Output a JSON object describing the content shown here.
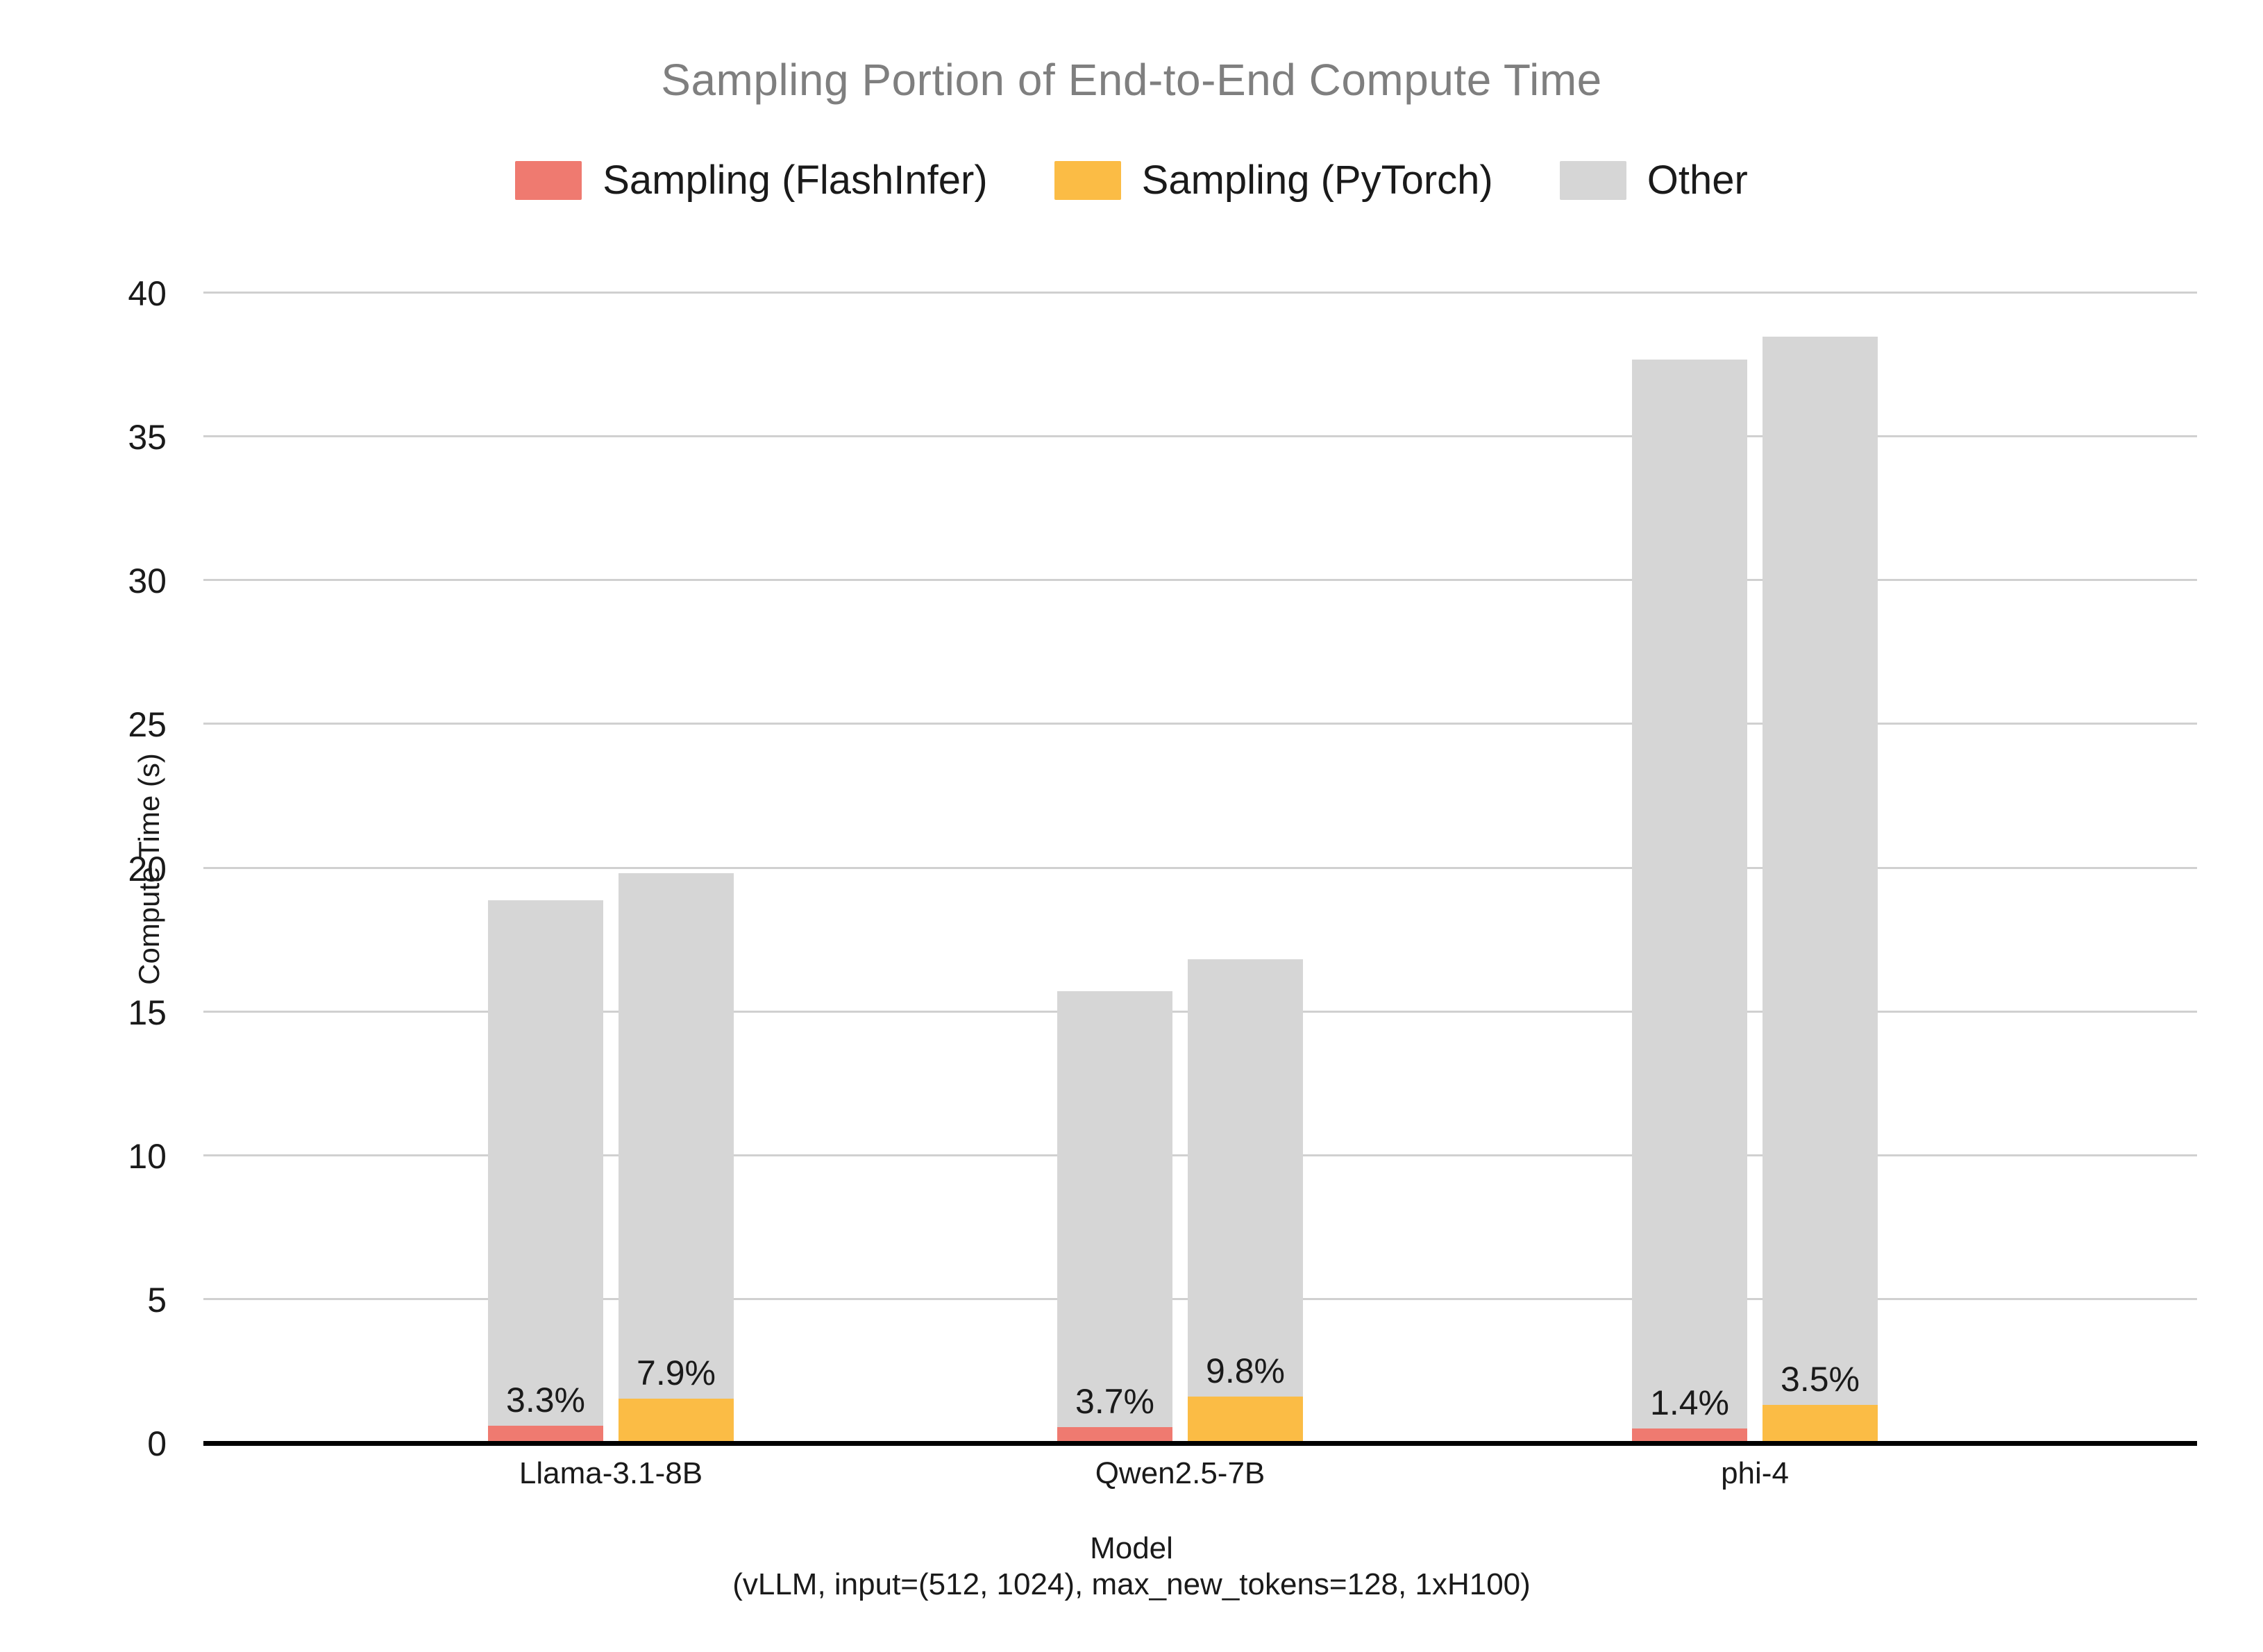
{
  "chart_data": {
    "type": "bar",
    "title": "Sampling Portion of End-to-End Compute Time",
    "xlabel": "Model",
    "xlabel_sub": "(vLLM, input=(512, 1024), max_new_tokens=128, 1xH100)",
    "ylabel": "Compute Time (s)",
    "ylim": [
      0,
      40
    ],
    "yticks": [
      0,
      5,
      10,
      15,
      20,
      25,
      30,
      35,
      40
    ],
    "ytick_labels": [
      "0",
      "5",
      "10",
      "15",
      "20",
      "25",
      "30",
      "35",
      "40"
    ],
    "grid": true,
    "legend_position": "top-center",
    "stacked": true,
    "grouped": true,
    "categories": [
      "Llama-3.1-8B",
      "Qwen2.5-7B",
      "phi-4"
    ],
    "legend": [
      {
        "label": "Sampling (FlashInfer)",
        "color": "#ef7a70"
      },
      {
        "label": "Sampling (PyTorch)",
        "color": "#fbbc45"
      },
      {
        "label": "Other",
        "color": "#d6d6d6"
      }
    ],
    "series": [
      {
        "name": "Sampling (FlashInfer)",
        "color": "#ef7a70",
        "values": [
          0.62,
          0.58,
          0.53
        ],
        "totals": [
          18.9,
          15.75,
          37.7
        ],
        "pct_labels": [
          "3.3%",
          "3.7%",
          "1.4%"
        ]
      },
      {
        "name": "Sampling (PyTorch)",
        "color": "#fbbc45",
        "values": [
          1.57,
          1.65,
          1.35
        ],
        "totals": [
          19.85,
          16.85,
          38.5
        ],
        "pct_labels": [
          "7.9%",
          "9.8%",
          "3.5%"
        ]
      }
    ],
    "other_color": "#d6d6d6",
    "bars": [
      {
        "group": "Llama-3.1-8B",
        "series": "Sampling (FlashInfer)",
        "total": 18.9,
        "sampling": 0.62,
        "other": 18.28,
        "pct_label": "3.3%"
      },
      {
        "group": "Llama-3.1-8B",
        "series": "Sampling (PyTorch)",
        "total": 19.85,
        "sampling": 1.57,
        "other": 18.28,
        "pct_label": "7.9%"
      },
      {
        "group": "Qwen2.5-7B",
        "series": "Sampling (FlashInfer)",
        "total": 15.75,
        "sampling": 0.58,
        "other": 15.17,
        "pct_label": "3.7%"
      },
      {
        "group": "Qwen2.5-7B",
        "series": "Sampling (PyTorch)",
        "total": 16.85,
        "sampling": 1.65,
        "other": 15.2,
        "pct_label": "9.8%"
      },
      {
        "group": "phi-4",
        "series": "Sampling (FlashInfer)",
        "total": 37.7,
        "sampling": 0.53,
        "other": 37.17,
        "pct_label": "1.4%"
      },
      {
        "group": "phi-4",
        "series": "Sampling (PyTorch)",
        "total": 38.5,
        "sampling": 1.35,
        "other": 37.15,
        "pct_label": "3.5%"
      }
    ]
  },
  "colors": {
    "title": "#7f7f7f",
    "text": "#1a1a1a",
    "grid": "#d0d0d0",
    "axis": "#000000",
    "background": "#ffffff"
  }
}
